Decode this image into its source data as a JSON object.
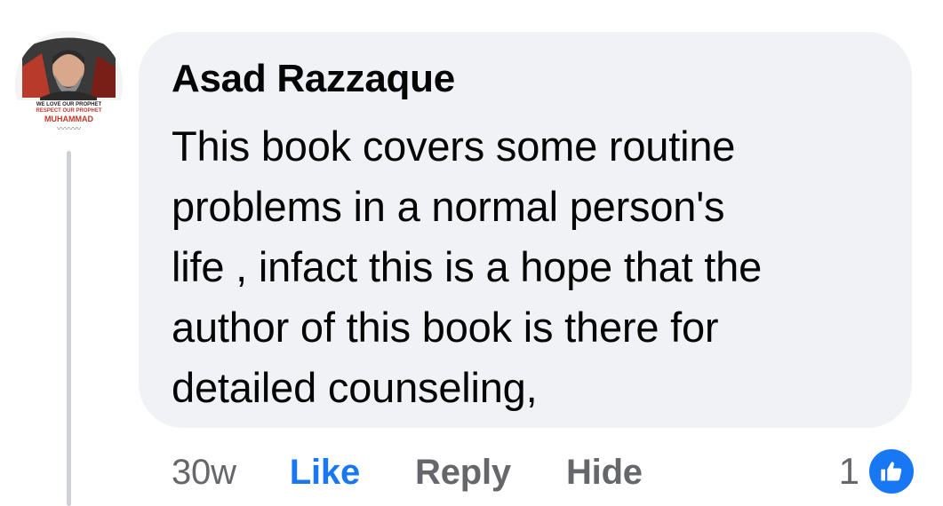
{
  "comment": {
    "author": "Asad Razzaque",
    "text_lines": [
      "This book covers some routine",
      "problems in a normal person's",
      "life , infact this is a hope that the",
      "author of this book is there for",
      "detailed counseling,"
    ],
    "avatar": {
      "caption_lines": [
        "WE LOVE OUR PROPHET",
        "RESPECT OUR PROPHET",
        "MUHAMMAD"
      ]
    }
  },
  "actions": {
    "time": "30w",
    "like_label": "Like",
    "reply_label": "Reply",
    "hide_label": "Hide"
  },
  "reactions": {
    "count": "1",
    "icon": "thumbs-up-icon"
  },
  "colors": {
    "bubble_bg": "#f0f2f5",
    "like_blue": "#1877f2",
    "muted_text": "#65676b",
    "text": "#050505"
  }
}
